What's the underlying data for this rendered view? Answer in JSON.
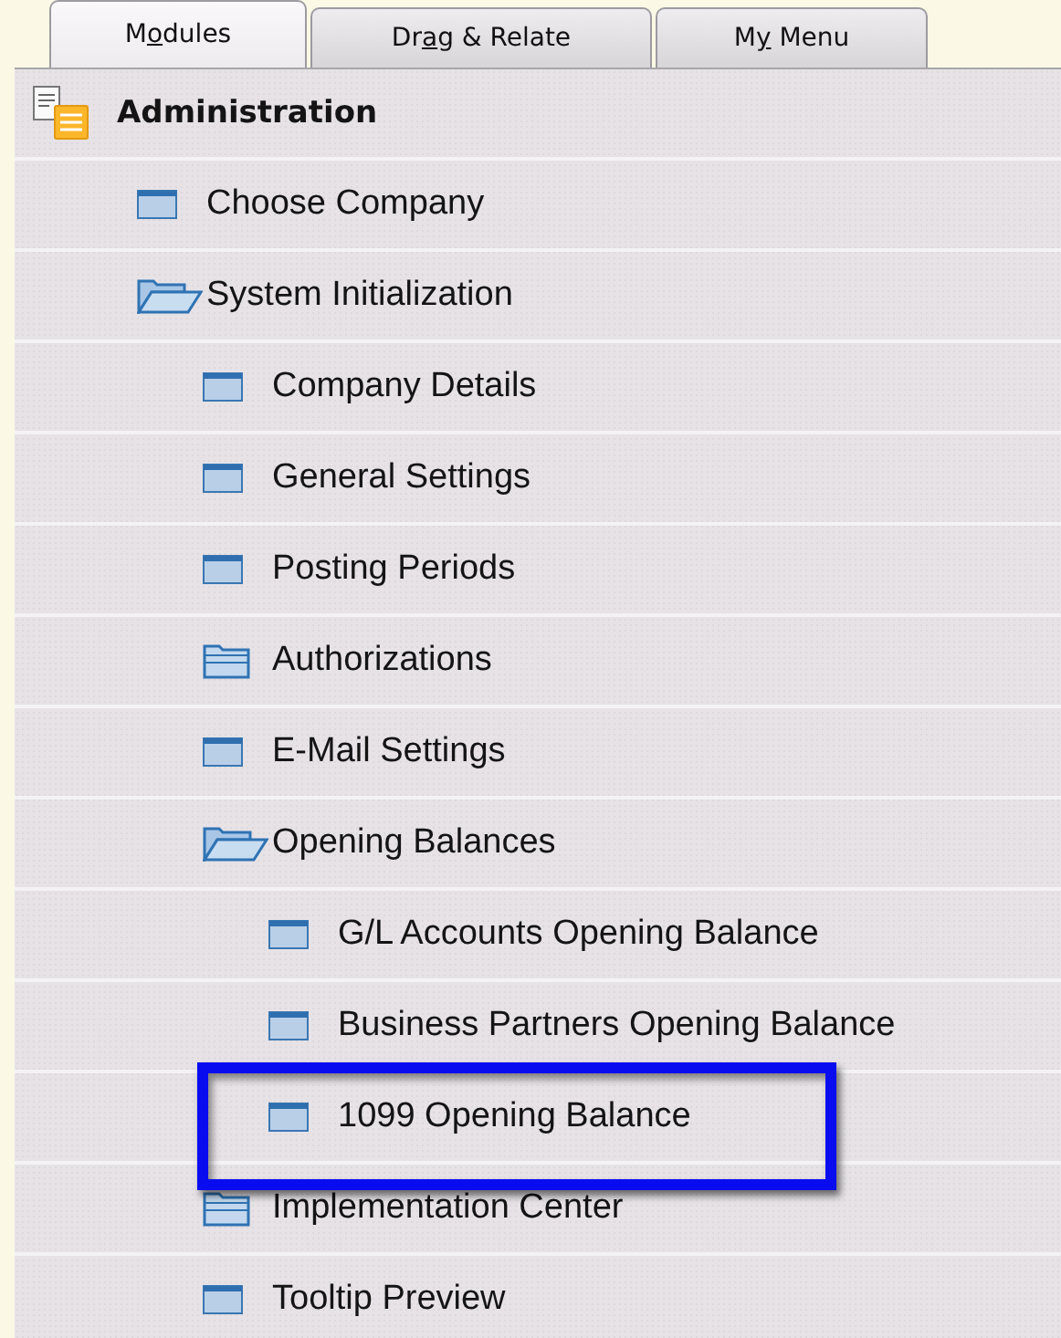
{
  "tabs": [
    {
      "label_parts": [
        {
          "text": "M",
          "underlined": false
        },
        {
          "text": "o",
          "underlined": true
        },
        {
          "text": "dules",
          "underlined": false
        }
      ],
      "selected": true
    },
    {
      "label_parts": [
        {
          "text": "Dr",
          "underlined": false
        },
        {
          "text": "a",
          "underlined": true
        },
        {
          "text": "g & Relate",
          "underlined": false
        }
      ],
      "selected": false
    },
    {
      "label_parts": [
        {
          "text": "M",
          "underlined": false
        },
        {
          "text": "y",
          "underlined": true
        },
        {
          "text": " Menu",
          "underlined": false
        }
      ],
      "selected": false
    }
  ],
  "module": {
    "title": "Administration"
  },
  "tree": [
    {
      "label": "Choose Company",
      "kind": "form",
      "highlighted": false
    },
    {
      "label": "System Initialization",
      "kind": "folder",
      "expanded": true,
      "children": [
        {
          "label": "Company Details",
          "kind": "form",
          "highlighted": false
        },
        {
          "label": "General Settings",
          "kind": "form",
          "highlighted": false
        },
        {
          "label": "Posting Periods",
          "kind": "form",
          "highlighted": false
        },
        {
          "label": "Authorizations",
          "kind": "folder",
          "expanded": false
        },
        {
          "label": "E-Mail Settings",
          "kind": "form",
          "highlighted": false
        },
        {
          "label": "Opening Balances",
          "kind": "folder",
          "expanded": true,
          "children": [
            {
              "label": "G/L Accounts Opening Balance",
              "kind": "form",
              "highlighted": false
            },
            {
              "label": "Business Partners Opening Balance",
              "kind": "form",
              "highlighted": false
            },
            {
              "label": "1099 Opening Balance",
              "kind": "form",
              "highlighted": true
            }
          ]
        },
        {
          "label": "Implementation Center",
          "kind": "folder",
          "expanded": false
        },
        {
          "label": "Tooltip Preview",
          "kind": "form",
          "highlighted": false
        }
      ]
    }
  ]
}
